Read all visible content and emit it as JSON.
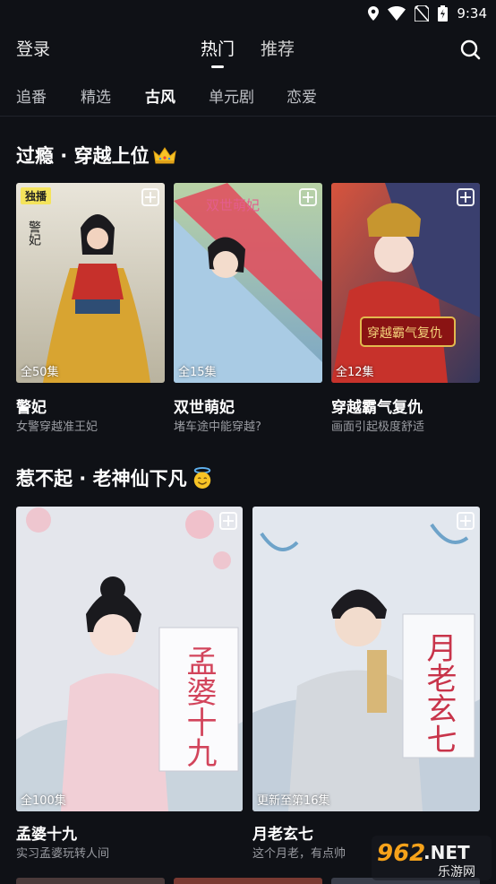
{
  "status_bar": {
    "time": "9:34"
  },
  "top_nav": {
    "login": "登录",
    "tabs": [
      {
        "label": "热门"
      },
      {
        "label": "推荐"
      }
    ]
  },
  "category_tabs": [
    {
      "label": "追番"
    },
    {
      "label": "精选"
    },
    {
      "label": "古风"
    },
    {
      "label": "单元剧"
    },
    {
      "label": "恋爱"
    }
  ],
  "sections": [
    {
      "title": "过瘾 · 穿越上位",
      "cards": [
        {
          "badge": "独播",
          "episodes": "全50集",
          "title": "警妃",
          "subtitle": "女警穿越准王妃",
          "poster_text": "警妃"
        },
        {
          "episodes": "全15集",
          "title": "双世萌妃",
          "subtitle": "堵车途中能穿越?",
          "poster_text": "双世萌妃"
        },
        {
          "episodes": "全12集",
          "title": "穿越霸气复仇",
          "subtitle": "画面引起极度舒适",
          "poster_text": "穿越霸气复仇"
        }
      ]
    },
    {
      "title": "惹不起 · 老神仙下凡",
      "cards": [
        {
          "episodes": "全100集",
          "title": "孟婆十九",
          "subtitle": "实习孟婆玩转人间",
          "poster_text": "孟婆十九"
        },
        {
          "episodes": "更新至第16集",
          "title": "月老玄七",
          "subtitle": "这个月老，有点帅",
          "poster_text": "月老玄七"
        }
      ]
    }
  ],
  "watermark": {
    "brand": "962",
    "suffix": ".NET",
    "sub": "乐游网"
  },
  "colors": {
    "background": "#0f1116",
    "accent": "#27d6b2",
    "badge": "#f4e35c"
  }
}
